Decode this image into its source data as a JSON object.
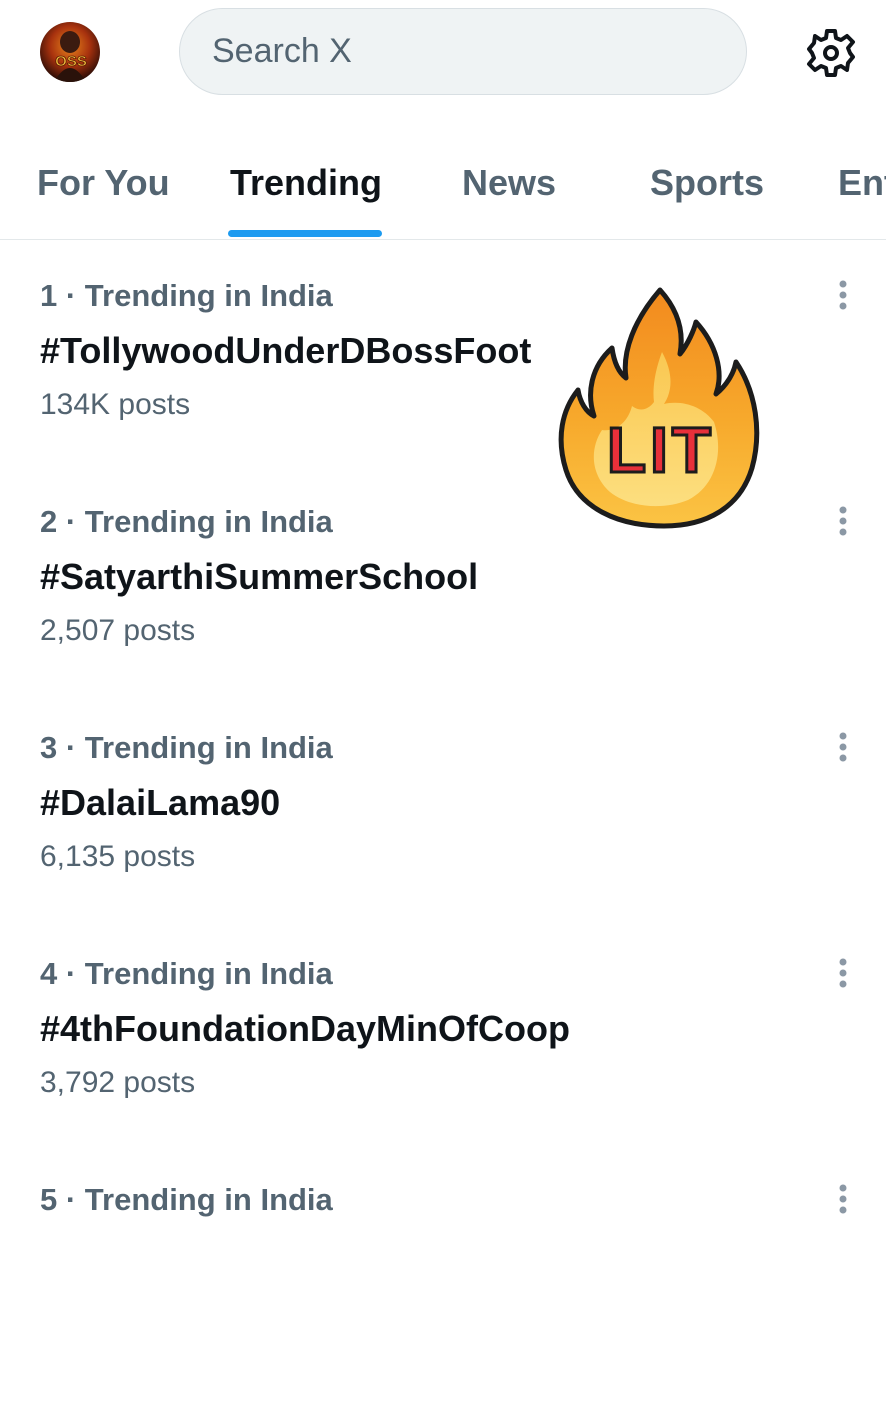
{
  "header": {
    "avatar_text": "OSS",
    "search_placeholder": "Search X",
    "settings_icon": "gear-icon"
  },
  "tabs": [
    {
      "label": "For You",
      "active": false
    },
    {
      "label": "Trending",
      "active": true
    },
    {
      "label": "News",
      "active": false
    },
    {
      "label": "Sports",
      "active": false
    },
    {
      "label": "Ent",
      "active": false
    }
  ],
  "trends": [
    {
      "meta": "1 · Trending in India",
      "name": "#TollywoodUnderDBossFoot",
      "posts": "134K posts"
    },
    {
      "meta": "2 · Trending in India",
      "name": "#SatyarthiSummerSchool",
      "posts": "2,507 posts"
    },
    {
      "meta": "3 · Trending in India",
      "name": "#DalaiLama90",
      "posts": "6,135 posts"
    },
    {
      "meta": "4 · Trending in India",
      "name": "#4thFoundationDayMinOfCoop",
      "posts": "3,792 posts"
    },
    {
      "meta": "5 · Trending in India",
      "name": "",
      "posts": ""
    }
  ],
  "sticker": {
    "text": "LIT",
    "icon": "fire-icon"
  },
  "colors": {
    "accent": "#1d9bf0",
    "primary_text": "#0f1419",
    "secondary_text": "#536471",
    "search_bg": "#eff3f4",
    "divider": "#e3e8ea"
  }
}
